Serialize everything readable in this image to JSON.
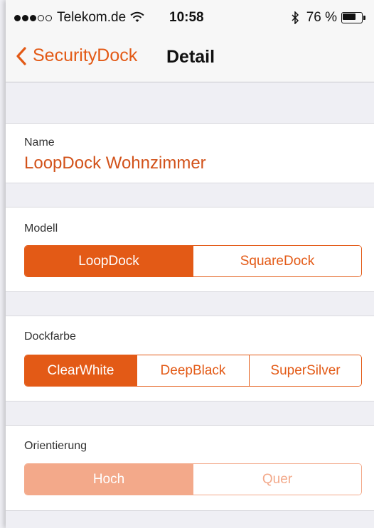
{
  "status_bar": {
    "signal_dots_filled": 3,
    "signal_dots_empty": 2,
    "carrier": "Telekom.de",
    "time": "10:58",
    "battery_percent": "76 %",
    "battery_level": 0.76
  },
  "nav": {
    "back_label": "SecurityDock",
    "title": "Detail"
  },
  "name_section": {
    "label": "Name",
    "value": "LoopDock Wohnzimmer"
  },
  "model_section": {
    "label": "Modell",
    "options": [
      "LoopDock",
      "SquareDock"
    ],
    "selected": 0
  },
  "color_section": {
    "label": "Dockfarbe",
    "options": [
      "ClearWhite",
      "DeepBlack",
      "SuperSilver"
    ],
    "selected": 0
  },
  "orientation_section": {
    "label": "Orientierung",
    "options": [
      "Hoch",
      "Quer"
    ],
    "selected": 0,
    "enabled": false
  },
  "colors": {
    "accent": "#e35a16",
    "accent_disabled": "#f3a98a",
    "background": "#efeff4"
  }
}
